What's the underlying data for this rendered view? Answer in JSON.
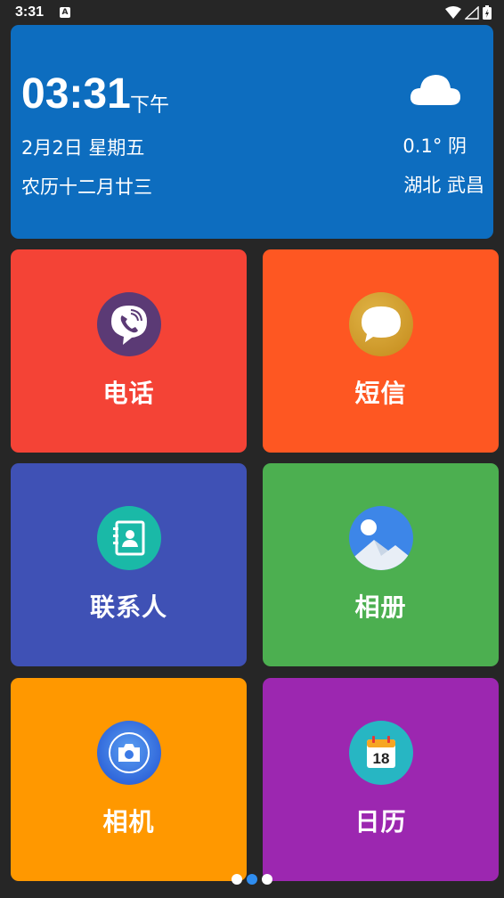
{
  "status_bar": {
    "time": "3:31",
    "notification_badge": "A",
    "icons": [
      "wifi-icon",
      "signal-icon",
      "battery-icon"
    ]
  },
  "clock_widget": {
    "time": "03:31",
    "ampm": "下午",
    "date": "2月2日 星期五",
    "lunar": "农历十二月廿三",
    "weather_icon": "cloud-icon",
    "temperature": "0.1° 阴",
    "location": "湖北 武昌",
    "color": "#0d6dbf"
  },
  "apps": [
    {
      "label": "电话",
      "icon": "phone-icon",
      "color": "#f44336"
    },
    {
      "label": "短信",
      "icon": "message-icon",
      "color": "#fe5722"
    },
    {
      "label": "联系人",
      "icon": "contacts-icon",
      "color": "#3f51b5"
    },
    {
      "label": "相册",
      "icon": "gallery-icon",
      "color": "#4caf50"
    },
    {
      "label": "相机",
      "icon": "camera-icon",
      "color": "#ff9800"
    },
    {
      "label": "日历",
      "icon": "calendar-icon",
      "color": "#9c27b0",
      "badge": "18"
    }
  ],
  "pager": {
    "pages": 3,
    "current": 2
  }
}
